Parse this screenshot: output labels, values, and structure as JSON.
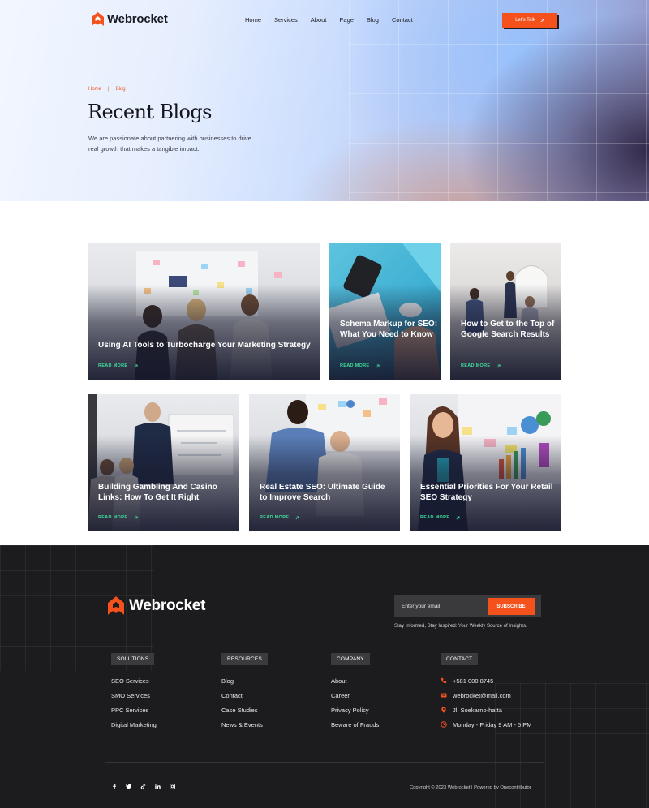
{
  "brand": {
    "name": "Webrocket",
    "accent": "#f5511d"
  },
  "nav": {
    "items": [
      "Home",
      "Services",
      "About",
      "Page",
      "Blog",
      "Contact"
    ]
  },
  "cta": {
    "label": "Let's Talk",
    "icon": "arrow-up-right-icon"
  },
  "breadcrumb": {
    "home": "Home",
    "separator": "|",
    "current": "Blog"
  },
  "hero": {
    "title": "Recent Blogs",
    "description": "We are passionate about partnering with businesses to drive real growth that makes a tangible impact."
  },
  "posts": [
    {
      "title": "Using AI Tools to Turbocharge Your Marketing Strategy",
      "read_more": "READ MORE"
    },
    {
      "title": "Schema Markup for SEO: What You Need to Know",
      "read_more": "READ MORE"
    },
    {
      "title": "How to Get to the Top of Google Search Results",
      "read_more": "READ MORE"
    },
    {
      "title": "Building Gambling And Casino Links: How To Get It Right",
      "read_more": "READ MORE"
    },
    {
      "title": "Real Estate SEO: Ultimate Guide to Improve Search",
      "read_more": "READ MORE"
    },
    {
      "title": "Essential Priorities For Your Retail SEO Strategy",
      "read_more": "READ MORE"
    }
  ],
  "footer": {
    "subscribe": {
      "placeholder": "Enter your email",
      "button": "SUBSCRIBE",
      "tagline": "Stay Informed, Stay Inspired: Your Weekly Source of  Insights."
    },
    "columns": [
      {
        "heading": "SOLUTIONS",
        "links": [
          "SEO Services",
          "SMO Services",
          "PPC Services",
          "Digital Marketing"
        ]
      },
      {
        "heading": "RESOURCES",
        "links": [
          "Blog",
          "Contact",
          "Case Studies",
          "News & Events"
        ]
      },
      {
        "heading": "COMPANY",
        "links": [
          "About",
          "Career",
          "Privacy Policy",
          "Beware of Frauds"
        ]
      }
    ],
    "contact": {
      "heading": "CONTACT",
      "items": [
        {
          "icon": "phone-icon",
          "text": "+581 000 8745"
        },
        {
          "icon": "mail-icon",
          "text": "webrocket@mail.com"
        },
        {
          "icon": "location-pin-icon",
          "text": "Jl. Soekarno-hatta"
        },
        {
          "icon": "clock-icon",
          "text": "Monday - Friday 9 AM - 5 PM"
        }
      ]
    },
    "socials": [
      "facebook-icon",
      "twitter-icon",
      "tiktok-icon",
      "linkedin-icon",
      "instagram-icon"
    ],
    "copyright": "Copyright © 2023 Webrocket | Powered by Onecontributor"
  }
}
